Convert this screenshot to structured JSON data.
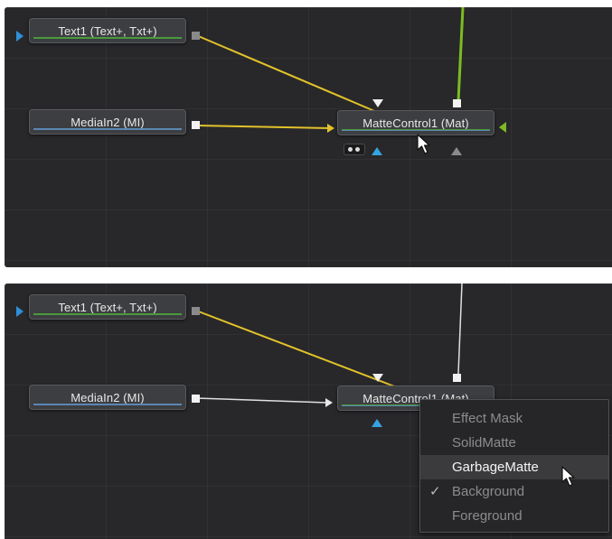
{
  "colors": {
    "canvas_bg": "#28282a",
    "node_bg": "#3d3e41",
    "wire_yellow": "#e2c22a",
    "wire_green": "#7dbb22",
    "wire_white": "#e0e0e0",
    "port_blue": "#2f8fd8",
    "menu_bg": "#262628",
    "menu_highlight": "#3b3b3e"
  },
  "top_view": {
    "nodes": {
      "text1": {
        "label": "Text1  (Text+, Txt+)"
      },
      "mediain2": {
        "label": "MediaIn2  (MI)"
      },
      "mattecontrol1": {
        "label": "MatteControl1  (Mat)"
      }
    }
  },
  "bottom_view": {
    "nodes": {
      "text1": {
        "label": "Text1  (Text+, Txt+)"
      },
      "mediain2": {
        "label": "MediaIn2  (MI)"
      },
      "mattecontrol1": {
        "label": "MatteControl1  (Mat)"
      }
    },
    "context_menu": {
      "items": [
        {
          "label": "Effect Mask",
          "checked": false,
          "highlighted": false
        },
        {
          "label": "SolidMatte",
          "checked": false,
          "highlighted": false
        },
        {
          "label": "GarbageMatte",
          "checked": false,
          "highlighted": true
        },
        {
          "label": "Background",
          "checked": true,
          "highlighted": false
        },
        {
          "label": "Foreground",
          "checked": false,
          "highlighted": false
        }
      ],
      "check_glyph": "✓"
    }
  },
  "icons": [
    "pointer-cursor-icon",
    "checkmark-icon",
    "input-triangle-icon",
    "output-port-icon"
  ]
}
